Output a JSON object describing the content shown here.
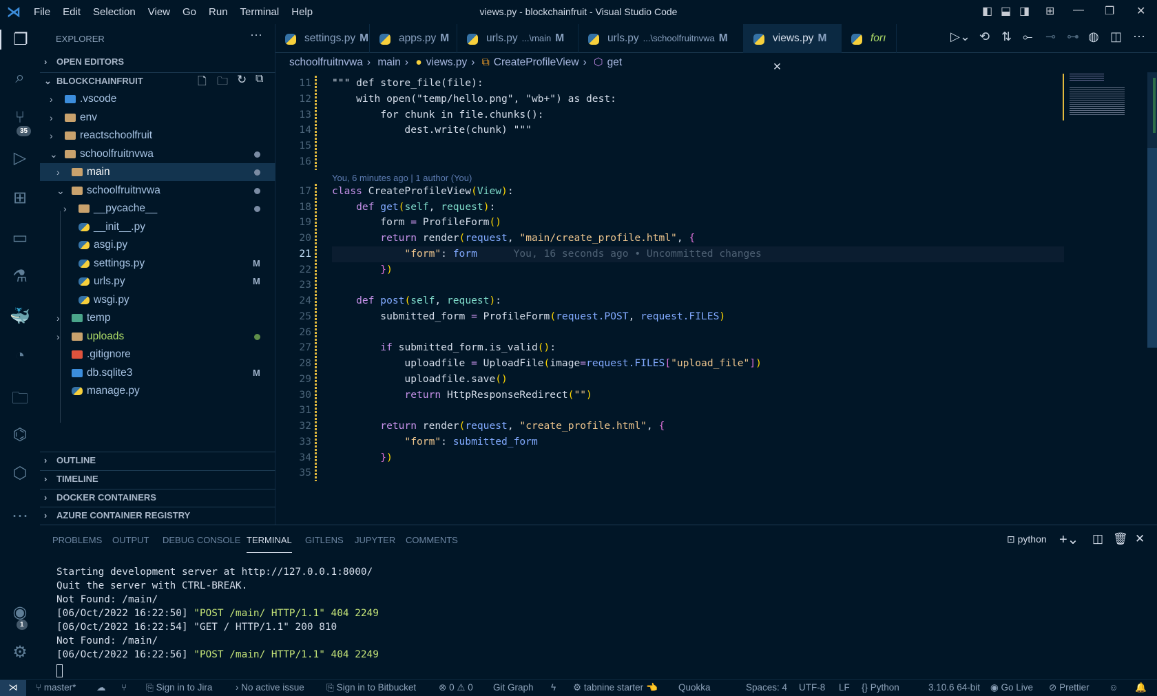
{
  "titlebar": {
    "title": "views.py - blockchainfruit - Visual Studio Code",
    "menu": [
      "File",
      "Edit",
      "Selection",
      "View",
      "Go",
      "Run",
      "Terminal",
      "Help"
    ]
  },
  "activity": {
    "source_control_badge": "35",
    "accounts_badge": "1"
  },
  "explorer": {
    "header": "EXPLORER",
    "open_editors": "OPEN EDITORS",
    "root": "BLOCKCHAINFRUIT",
    "items": [
      {
        "label": ".vscode",
        "depth": 0,
        "kind": "vscode",
        "chev": ">"
      },
      {
        "label": "env",
        "depth": 0,
        "kind": "folder",
        "chev": ">"
      },
      {
        "label": "reactschoolfruit",
        "depth": 0,
        "kind": "folder",
        "chev": ">"
      },
      {
        "label": "schoolfruitnvwa",
        "depth": 0,
        "kind": "folder-open",
        "chev": "v",
        "dot": true
      },
      {
        "label": "main",
        "depth": 1,
        "kind": "folder",
        "chev": ">",
        "dot": true,
        "selected": true
      },
      {
        "label": "schoolfruitnvwa",
        "depth": 1,
        "kind": "folder-open",
        "chev": "v",
        "dot": true
      },
      {
        "label": "__pycache__",
        "depth": 2,
        "kind": "folder",
        "chev": ">",
        "dot": true
      },
      {
        "label": "__init__.py",
        "depth": 2,
        "kind": "py"
      },
      {
        "label": "asgi.py",
        "depth": 2,
        "kind": "py"
      },
      {
        "label": "settings.py",
        "depth": 2,
        "kind": "py",
        "mark": "M"
      },
      {
        "label": "urls.py",
        "depth": 2,
        "kind": "py",
        "mark": "M"
      },
      {
        "label": "wsgi.py",
        "depth": 2,
        "kind": "py"
      },
      {
        "label": "temp",
        "depth": 1,
        "kind": "temp",
        "chev": ">"
      },
      {
        "label": "uploads",
        "depth": 1,
        "kind": "folder",
        "chev": ">",
        "dot": true,
        "green": true
      },
      {
        "label": ".gitignore",
        "depth": 1,
        "kind": "git"
      },
      {
        "label": "db.sqlite3",
        "depth": 1,
        "kind": "db",
        "mark": "M"
      },
      {
        "label": "manage.py",
        "depth": 1,
        "kind": "py"
      }
    ],
    "sections": [
      "OUTLINE",
      "TIMELINE",
      "DOCKER CONTAINERS",
      "AZURE CONTAINER REGISTRY"
    ]
  },
  "tabs": [
    {
      "label": "settings.py",
      "mark": "M"
    },
    {
      "label": "apps.py",
      "mark": "M"
    },
    {
      "label": "urls.py",
      "desc": "...\\main",
      "mark": "M"
    },
    {
      "label": "urls.py",
      "desc": "...\\schoolfruitnvwa",
      "mark": "M"
    },
    {
      "label": "views.py",
      "mark": "M",
      "active": true,
      "close": "✕"
    },
    {
      "label": "forı",
      "preview": true
    }
  ],
  "breadcrumb": [
    "schoolfruitnvwa",
    "main",
    "views.py",
    "CreateProfileView",
    "get"
  ],
  "editor": {
    "codelens": "You, 6 minutes ago | 1 author (You)",
    "blame": "You, 16 seconds ago • Uncommitted changes",
    "current_line": 21,
    "lines": [
      {
        "n": 11,
        "t": [
          [
            "\"\"\" def store_file(file):",
            "pl"
          ]
        ]
      },
      {
        "n": 12,
        "t": [
          [
            "    with open(\"temp/hello.png\", \"wb+\") as dest:",
            "pl"
          ]
        ]
      },
      {
        "n": 13,
        "t": [
          [
            "        for chunk in file.chunks():",
            "pl"
          ]
        ]
      },
      {
        "n": 14,
        "t": [
          [
            "            dest.write(chunk) \"\"\"",
            "pl"
          ]
        ]
      },
      {
        "n": 15,
        "t": []
      },
      {
        "n": 16,
        "t": []
      },
      {
        "n": 17,
        "t": [
          [
            "class ",
            "kw"
          ],
          [
            "CreateProfileView",
            "pl"
          ],
          [
            "(",
            "par"
          ],
          [
            "View",
            "prm"
          ],
          [
            ")",
            "par"
          ],
          [
            ":",
            "pu"
          ]
        ]
      },
      {
        "n": 18,
        "t": [
          [
            "    def ",
            "kw"
          ],
          [
            "get",
            "fn"
          ],
          [
            "(",
            "par"
          ],
          [
            "self",
            "prm"
          ],
          [
            ", ",
            "pu"
          ],
          [
            "request",
            "prm"
          ],
          [
            ")",
            "par"
          ],
          [
            ":",
            "pu"
          ]
        ]
      },
      {
        "n": 19,
        "t": [
          [
            "        form ",
            "pl"
          ],
          [
            "= ",
            "kw"
          ],
          [
            "ProfileForm",
            "pl"
          ],
          [
            "()",
            "par"
          ]
        ]
      },
      {
        "n": 20,
        "t": [
          [
            "        return ",
            "kw"
          ],
          [
            "render",
            "pl"
          ],
          [
            "(",
            "par"
          ],
          [
            "request",
            "vr"
          ],
          [
            ", ",
            "pu"
          ],
          [
            "\"main/create_profile.html\"",
            "str"
          ],
          [
            ", ",
            "pu"
          ],
          [
            "{",
            "br"
          ]
        ]
      },
      {
        "n": 21,
        "t": [
          [
            "            \"form\"",
            "str"
          ],
          [
            ": ",
            "pu"
          ],
          [
            "form",
            "vr"
          ]
        ]
      },
      {
        "n": 22,
        "t": [
          [
            "        }",
            "br"
          ],
          [
            ")",
            "par"
          ]
        ]
      },
      {
        "n": 23,
        "t": []
      },
      {
        "n": 24,
        "t": [
          [
            "    def ",
            "kw"
          ],
          [
            "post",
            "fn"
          ],
          [
            "(",
            "par"
          ],
          [
            "self",
            "prm"
          ],
          [
            ", ",
            "pu"
          ],
          [
            "request",
            "prm"
          ],
          [
            ")",
            "par"
          ],
          [
            ":",
            "pu"
          ]
        ]
      },
      {
        "n": 25,
        "t": [
          [
            "        submitted_form ",
            "pl"
          ],
          [
            "= ",
            "kw"
          ],
          [
            "ProfileForm",
            "pl"
          ],
          [
            "(",
            "par"
          ],
          [
            "request.POST",
            "vr"
          ],
          [
            ", ",
            "pu"
          ],
          [
            "request.FILES",
            "vr"
          ],
          [
            ")",
            "par"
          ]
        ]
      },
      {
        "n": 26,
        "t": []
      },
      {
        "n": 27,
        "t": [
          [
            "        if ",
            "kw"
          ],
          [
            "submitted_form.is_valid",
            "pl"
          ],
          [
            "()",
            "par"
          ],
          [
            ":",
            "pu"
          ]
        ]
      },
      {
        "n": 28,
        "t": [
          [
            "            uploadfile ",
            "pl"
          ],
          [
            "= ",
            "kw"
          ],
          [
            "UploadFile",
            "pl"
          ],
          [
            "(",
            "par"
          ],
          [
            "image",
            "pl"
          ],
          [
            "=",
            "kw"
          ],
          [
            "request.FILES",
            "vr"
          ],
          [
            "[",
            "br"
          ],
          [
            "\"upload_file\"",
            "str"
          ],
          [
            "]",
            "br"
          ],
          [
            ")",
            "par"
          ]
        ]
      },
      {
        "n": 29,
        "t": [
          [
            "            uploadfile.save",
            "pl"
          ],
          [
            "()",
            "par"
          ]
        ]
      },
      {
        "n": 30,
        "t": [
          [
            "            return ",
            "kw"
          ],
          [
            "HttpResponseRedirect",
            "pl"
          ],
          [
            "(",
            "par"
          ],
          [
            "\"\"",
            "str"
          ],
          [
            ")",
            "par"
          ]
        ]
      },
      {
        "n": 31,
        "t": []
      },
      {
        "n": 32,
        "t": [
          [
            "        return ",
            "kw"
          ],
          [
            "render",
            "pl"
          ],
          [
            "(",
            "par"
          ],
          [
            "request",
            "vr"
          ],
          [
            ", ",
            "pu"
          ],
          [
            "\"create_profile.html\"",
            "str"
          ],
          [
            ", ",
            "pu"
          ],
          [
            "{",
            "br"
          ]
        ]
      },
      {
        "n": 33,
        "t": [
          [
            "            \"form\"",
            "str"
          ],
          [
            ": ",
            "pu"
          ],
          [
            "submitted_form",
            "vr"
          ]
        ]
      },
      {
        "n": 34,
        "t": [
          [
            "        }",
            "br"
          ],
          [
            ")",
            "par"
          ]
        ]
      },
      {
        "n": 35,
        "t": []
      }
    ]
  },
  "panel": {
    "tabs": [
      "PROBLEMS",
      "OUTPUT",
      "DEBUG CONSOLE",
      "TERMINAL",
      "GITLENS",
      "JUPYTER",
      "COMMENTS"
    ],
    "active": "TERMINAL",
    "shell": "python",
    "terminal": [
      {
        "plain": "Starting development server at http://127.0.0.1:8000/"
      },
      {
        "plain": "Quit the server with CTRL-BREAK."
      },
      {
        "plain": "Not Found: /main/"
      },
      {
        "plain": "[06/Oct/2022 16:22:50] ",
        "green": "\"POST /main/ HTTP/1.1\" 404 2249"
      },
      {
        "plain": "[06/Oct/2022 16:22:54] \"GET / HTTP/1.1\" 200 810"
      },
      {
        "plain": "Not Found: /main/"
      },
      {
        "plain": "[06/Oct/2022 16:22:56] ",
        "green": "\"POST /main/ HTTP/1.1\" 404 2249"
      }
    ]
  },
  "status": {
    "branch": "master*",
    "jira": "Sign in to Jira",
    "issue": "No active issue",
    "bitbucket": "Sign in to Bitbucket",
    "errors": "0",
    "warnings": "0",
    "gitgraph": "Git Graph",
    "tabnine": "tabnine starter",
    "quokka": "Quokka",
    "spaces": "Spaces: 4",
    "encoding": "UTF-8",
    "eol": "LF",
    "language": "Python",
    "interpreter": "3.10.6 64-bit",
    "golive": "Go Live",
    "prettier": "Prettier"
  }
}
